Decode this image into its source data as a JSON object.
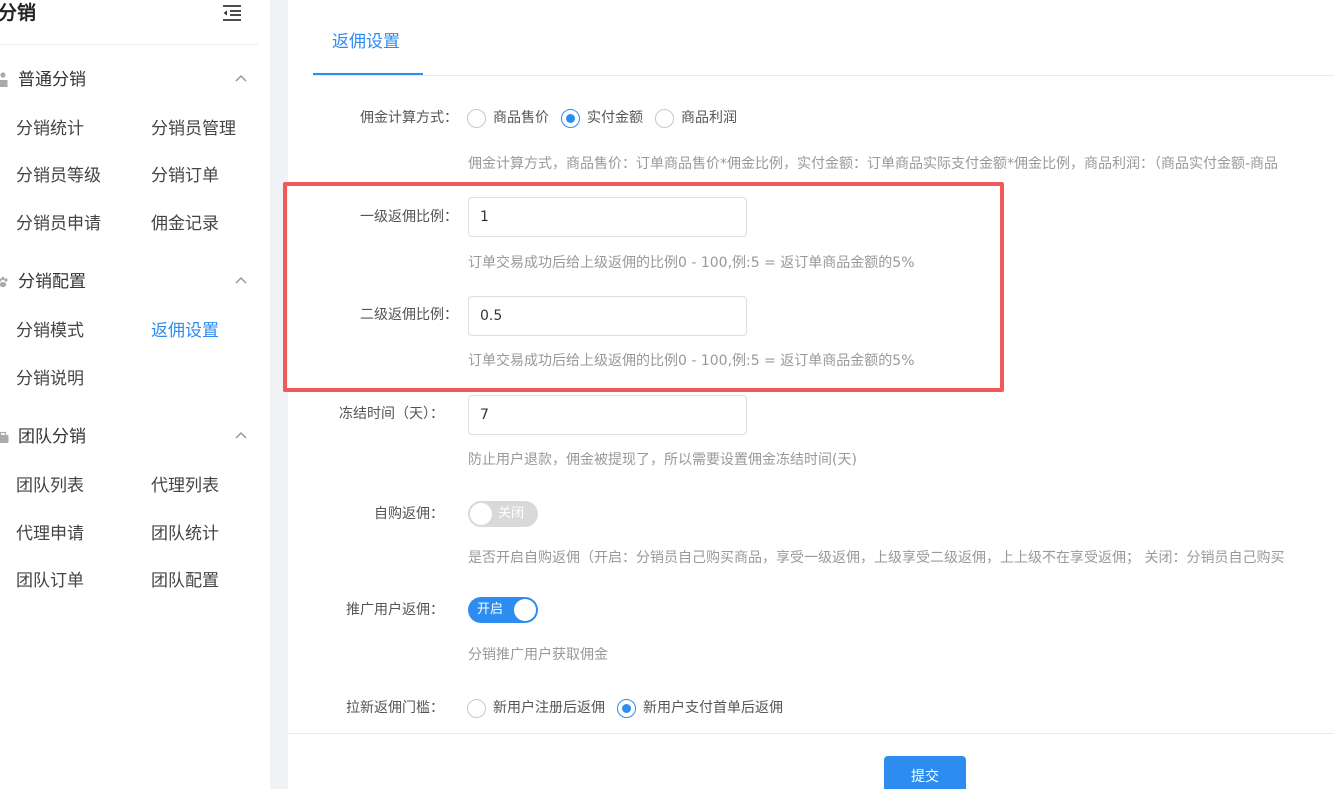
{
  "sidebar": {
    "title": "分销",
    "groups": [
      {
        "label": "普通分销",
        "items": [
          "分销统计",
          "分销员管理",
          "分销员等级",
          "分销订单",
          "分销员申请",
          "佣金记录"
        ]
      },
      {
        "label": "分销配置",
        "items": [
          "分销模式",
          "返佣设置",
          "分销说明"
        ]
      },
      {
        "label": "团队分销",
        "items": [
          "团队列表",
          "代理列表",
          "代理申请",
          "团队统计",
          "团队订单",
          "团队配置"
        ]
      }
    ],
    "active_item": "返佣设置"
  },
  "tabs": {
    "active": "返佣设置"
  },
  "form": {
    "calc_method": {
      "label": "佣金计算方式：",
      "options": [
        "商品售价",
        "实付金额",
        "商品利润"
      ],
      "selected": "实付金额",
      "help": "佣金计算方式，商品售价：订单商品售价*佣金比例，实付金额：订单商品实际支付金额*佣金比例，商品利润：（商品实付金额-商品"
    },
    "level1": {
      "label": "一级返佣比例：",
      "value": "1",
      "help": "订单交易成功后给上级返佣的比例0 - 100,例:5 = 返订单商品金额的5%"
    },
    "level2": {
      "label": "二级返佣比例：",
      "value": "0.5",
      "help": "订单交易成功后给上级返佣的比例0 - 100,例:5 = 返订单商品金额的5%"
    },
    "freeze": {
      "label": "冻结时间（天）：",
      "value": "7",
      "help": "防止用户退款，佣金被提现了，所以需要设置佣金冻结时间(天)"
    },
    "self_purchase": {
      "label": "自购返佣：",
      "state": "关闭",
      "enabled": false,
      "help": "是否开启自购返佣（开启：分销员自己购买商品，享受一级返佣，上级享受二级返佣，上上级不在享受返佣； 关闭：分销员自己购买"
    },
    "promote": {
      "label": "推广用户返佣：",
      "state": "开启",
      "enabled": true,
      "help": "分销推广用户获取佣金"
    },
    "new_user_threshold": {
      "label": "拉新返佣门槛：",
      "options": [
        "新用户注册后返佣",
        "新用户支付首单后返佣"
      ],
      "selected": "新用户支付首单后返佣"
    }
  },
  "footer": {
    "submit_label": "提交"
  },
  "colors": {
    "primary": "#2d8cf0",
    "highlight": "#f05a5a"
  }
}
